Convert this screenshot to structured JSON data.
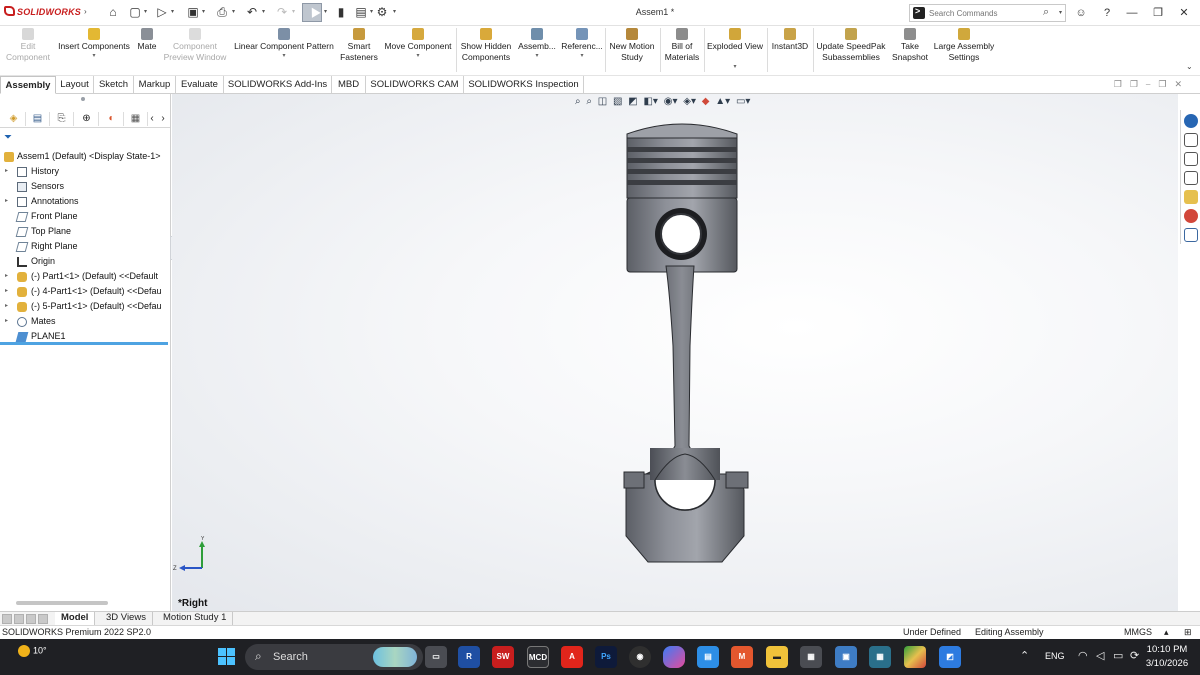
{
  "app": {
    "brand": "SOLIDWORKS",
    "doc_title": "Assem1 *",
    "search": {
      "placeholder": "Search Commands"
    }
  },
  "ribbon": {
    "commands": [
      {
        "label": "Edit Component",
        "disabled": true
      },
      {
        "label": "Insert Components",
        "disabled": false
      },
      {
        "label": "Mate",
        "disabled": false
      },
      {
        "label": "Component Preview Window",
        "disabled": true
      },
      {
        "label": "Linear Component Pattern",
        "disabled": false
      },
      {
        "label": "Smart Fasteners",
        "disabled": false
      },
      {
        "label": "Move Component",
        "disabled": false
      },
      {
        "label": "Show Hidden Components",
        "disabled": false
      },
      {
        "label": "Assemb...",
        "disabled": false
      },
      {
        "label": "Referenc...",
        "disabled": false
      },
      {
        "label": "New Motion Study",
        "disabled": false
      },
      {
        "label": "Bill of Materials",
        "disabled": false
      },
      {
        "label": "Exploded View",
        "disabled": false
      },
      {
        "label": "Instant3D",
        "disabled": false
      },
      {
        "label": "Update SpeedPak Subassemblies",
        "disabled": false
      },
      {
        "label": "Take Snapshot",
        "disabled": false
      },
      {
        "label": "Large Assembly Settings",
        "disabled": false
      }
    ]
  },
  "tabs": [
    "Assembly",
    "Layout",
    "Sketch",
    "Markup",
    "Evaluate",
    "SOLIDWORKS Add-Ins",
    "MBD",
    "SOLIDWORKS CAM",
    "SOLIDWORKS Inspection"
  ],
  "active_tab": "Assembly",
  "tree": {
    "root": "Assem1 (Default) <Display State-1>",
    "items": [
      {
        "label": "History",
        "icon": "history-icon",
        "expandable": true
      },
      {
        "label": "Sensors",
        "icon": "sensors-icon",
        "expandable": false
      },
      {
        "label": "Annotations",
        "icon": "annotations-icon",
        "expandable": true
      },
      {
        "label": "Front Plane",
        "icon": "plane-icon",
        "expandable": false
      },
      {
        "label": "Top Plane",
        "icon": "plane-icon",
        "expandable": false
      },
      {
        "label": "Right Plane",
        "icon": "plane-icon",
        "expandable": false
      },
      {
        "label": "Origin",
        "icon": "origin-icon",
        "expandable": false
      },
      {
        "label": "(-) Part1<1> (Default) <<Default",
        "icon": "part-icon",
        "expandable": true
      },
      {
        "label": "(-) 4-Part1<1> (Default) <<Defau",
        "icon": "part-icon",
        "expandable": true
      },
      {
        "label": "(-) 5-Part1<1> (Default) <<Defau",
        "icon": "part-icon",
        "expandable": true
      },
      {
        "label": "Mates",
        "icon": "mates-icon",
        "expandable": true
      },
      {
        "label": "PLANE1",
        "icon": "plane-icon",
        "expandable": false
      }
    ]
  },
  "viewport": {
    "view_label": "*Right",
    "triad": {
      "y": "Y",
      "z": "Z"
    }
  },
  "bottom_tabs": [
    "Model",
    "3D Views",
    "Motion Study 1"
  ],
  "active_bottom_tab": "Model",
  "status": {
    "product": "SOLIDWORKS Premium 2022 SP2.0",
    "definition": "Under Defined",
    "mode": "Editing Assembly",
    "units": "MMGS"
  },
  "taskbar": {
    "weather": "10°",
    "search_label": "Search",
    "language": "ENG",
    "time": "10:10 PM",
    "date": "3/10/2026",
    "apps": [
      "Revit",
      "SOLIDWORKS 2022",
      "MCD",
      "AutoCAD",
      "Photoshop",
      "Chrome",
      "Copilot",
      "Notepad",
      "Mars",
      "File Explorer",
      "Calculator",
      "Photos",
      "Media",
      "BlueStacks",
      "Paint"
    ]
  },
  "colors": {
    "brand_red": "#c81e1e",
    "active_blue": "#4ea3e2",
    "taskbar_bg": "#1f2024"
  }
}
